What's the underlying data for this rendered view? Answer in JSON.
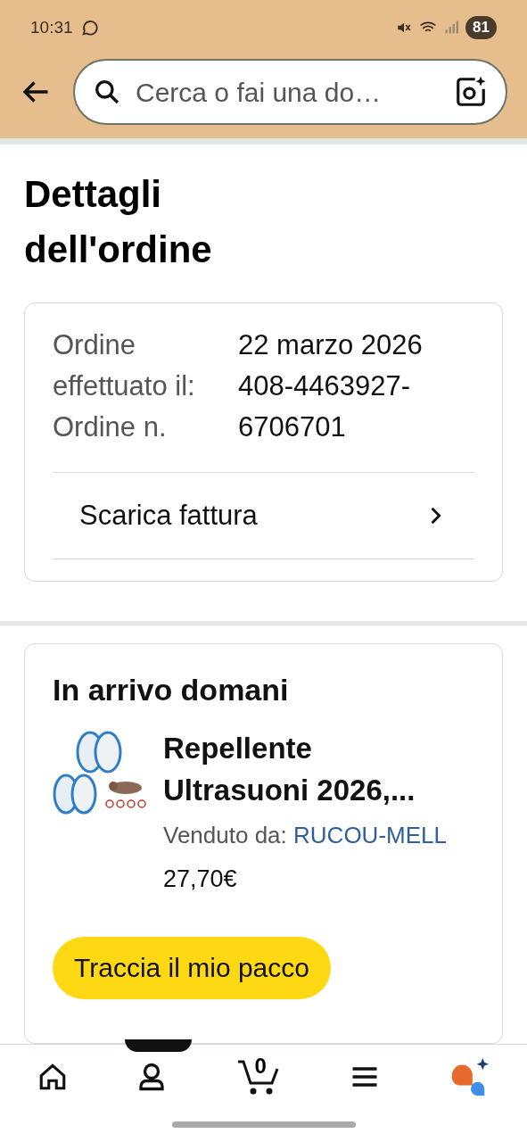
{
  "status_bar": {
    "time": "10:31",
    "battery": "81"
  },
  "search": {
    "placeholder": "Cerca o fai una do…"
  },
  "title": "Dettagli dell'ordine",
  "order": {
    "fields": [
      {
        "label": "Ordine effettuato il:",
        "value": "22 marzo 2026"
      },
      {
        "label": "Ordine n.",
        "value": "408-4463927-6706701"
      }
    ],
    "invoice_link": "Scarica fattura"
  },
  "shipment": {
    "heading": "In arrivo domani",
    "items": [
      {
        "kind": "picture",
        "title": "Repellente Ultrasuoni 2026,...",
        "seller_label": "Venduto da:",
        "seller": "RUCOU-MELL",
        "price": "27,70€"
      }
    ],
    "track_button": "Traccia il mio pacco"
  },
  "bottom_nav": {
    "cart_count": "0"
  }
}
